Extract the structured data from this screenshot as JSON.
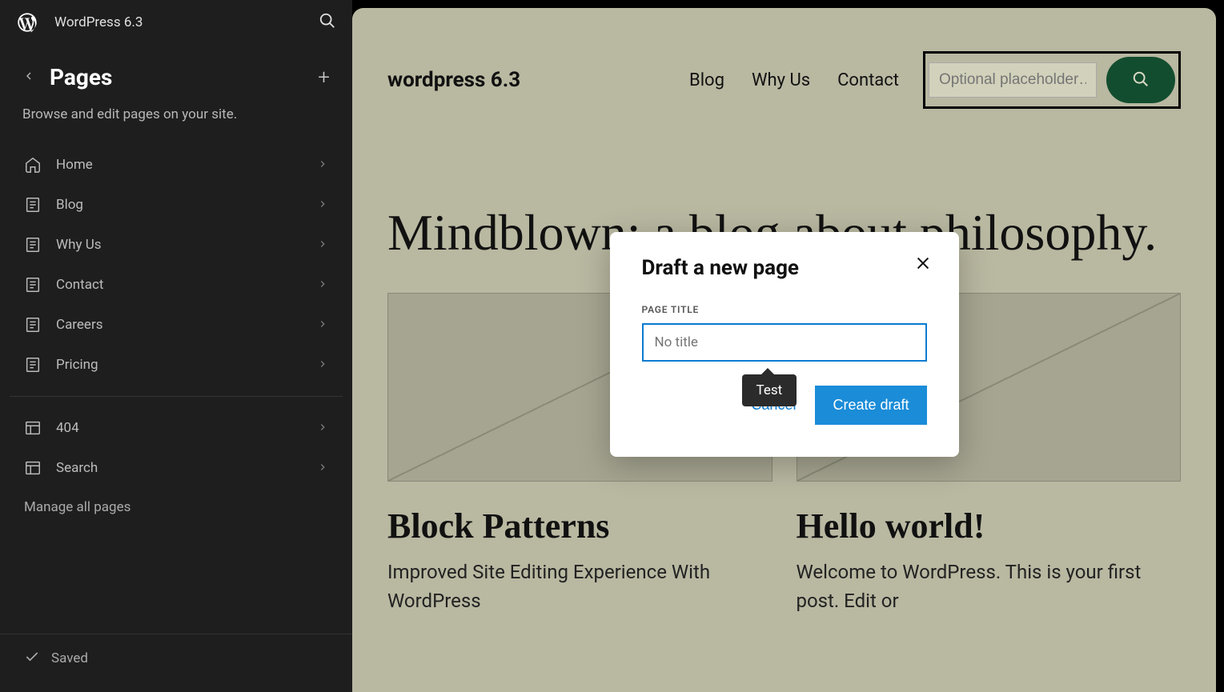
{
  "app": {
    "title": "WordPress 6.3"
  },
  "sidebar": {
    "section_title": "Pages",
    "description": "Browse and edit pages on your site.",
    "items": [
      {
        "label": "Home",
        "icon": "home-icon"
      },
      {
        "label": "Blog",
        "icon": "page-icon"
      },
      {
        "label": "Why Us",
        "icon": "page-icon"
      },
      {
        "label": "Contact",
        "icon": "page-icon"
      },
      {
        "label": "Careers",
        "icon": "page-icon"
      },
      {
        "label": "Pricing",
        "icon": "page-icon"
      }
    ],
    "items2": [
      {
        "label": "404",
        "icon": "layout-icon"
      },
      {
        "label": "Search",
        "icon": "layout-icon"
      }
    ],
    "manage_label": "Manage all pages",
    "saved_label": "Saved"
  },
  "preview": {
    "site_title": "wordpress 6.3",
    "nav": [
      "Blog",
      "Why Us",
      "Contact"
    ],
    "search_placeholder": "Optional placeholder…",
    "hero": "Mindblown: a blog about philosophy.",
    "posts": [
      {
        "title": "Block Patterns",
        "excerpt": "Improved Site Editing Experience With WordPress"
      },
      {
        "title": "Hello world!",
        "excerpt": "Welcome to WordPress. This is your first post. Edit or"
      }
    ]
  },
  "modal": {
    "title": "Draft a new page",
    "label": "PAGE TITLE",
    "placeholder": "No title",
    "cancel": "Cancel",
    "submit": "Create draft",
    "tooltip": "Test"
  }
}
